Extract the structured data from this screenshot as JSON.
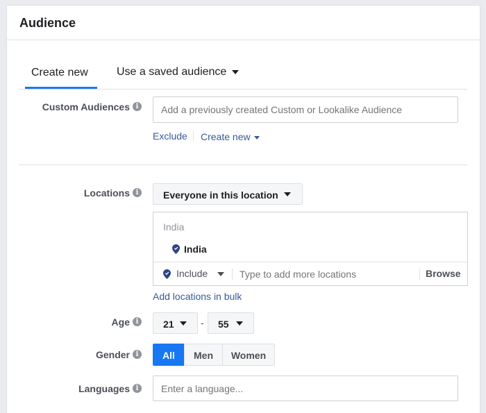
{
  "panel": {
    "title": "Audience"
  },
  "tabs": [
    {
      "label": "Create new",
      "active": true
    },
    {
      "label": "Use a saved audience",
      "has_dropdown": true
    }
  ],
  "custom_audiences": {
    "label": "Custom Audiences",
    "placeholder": "Add a previously created Custom or Lookalike Audience",
    "exclude_label": "Exclude",
    "create_new_label": "Create new"
  },
  "locations": {
    "label": "Locations",
    "scope_dropdown": "Everyone in this location",
    "country_header": "India",
    "selected": [
      "India"
    ],
    "include_label": "Include",
    "search_placeholder": "Type to add more locations",
    "browse_label": "Browse",
    "bulk_link": "Add locations in bulk"
  },
  "age": {
    "label": "Age",
    "min": "21",
    "separator": "-",
    "max": "55"
  },
  "gender": {
    "label": "Gender",
    "options": [
      "All",
      "Men",
      "Women"
    ],
    "selected": "All"
  },
  "languages": {
    "label": "Languages",
    "placeholder": "Enter a language..."
  },
  "colors": {
    "accent": "#1877f2",
    "link": "#385898",
    "pin": "#2d4486"
  },
  "icons": [
    "info-icon",
    "caret-down-icon",
    "location-pin-icon"
  ]
}
